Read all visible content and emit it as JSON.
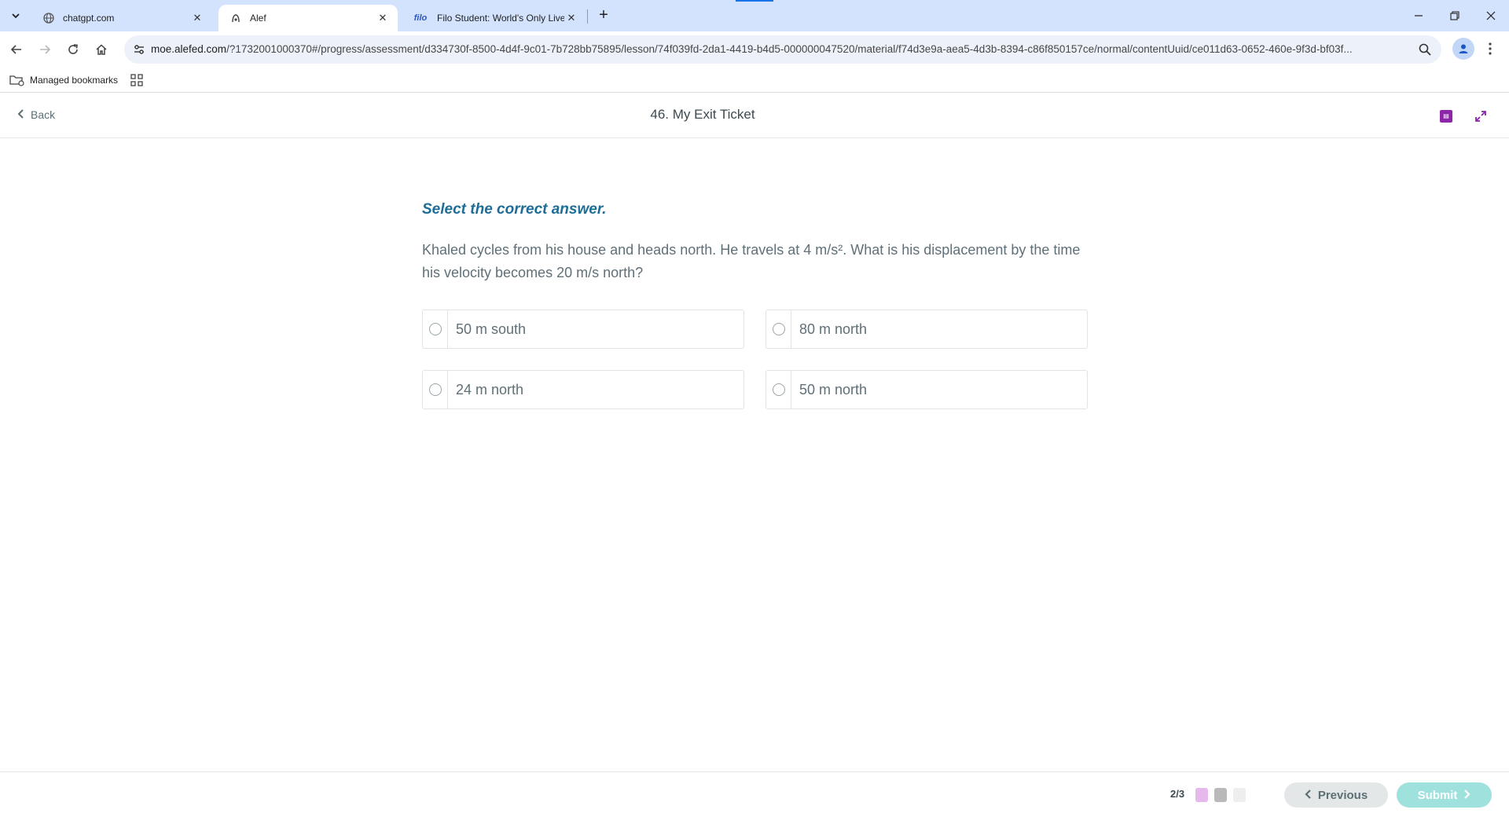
{
  "browser": {
    "tabs": [
      {
        "title": "chatgpt.com",
        "icon": "globe-icon"
      },
      {
        "title": "Alef",
        "icon": "alef-icon"
      },
      {
        "title": "Filo Student: World's Only Live",
        "icon": "filo-icon",
        "icon_text": "filo"
      }
    ],
    "url_host": "moe.alefed.com",
    "url_path": "/?1732001000370#/progress/assessment/d334730f-8500-4d4f-9c01-7b728bb75895/lesson/74f039fd-2da1-4419-b4d5-000000047520/material/f74d3e9a-aea5-4d3b-8394-c86f850157ce/normal/contentUuid/ce011d63-0652-460e-9f3d-bf03f...",
    "bookmarks_label": "Managed bookmarks"
  },
  "header": {
    "back_label": "Back",
    "title": "46. My Exit Ticket"
  },
  "question": {
    "instruction": "Select the correct answer.",
    "text": "Khaled cycles from his house and heads north. He travels at 4 m/s². What is his displacement by the time his velocity becomes 20 m/s north?",
    "options": [
      "50 m south",
      "80 m north",
      "24 m north",
      "50 m north"
    ]
  },
  "footer": {
    "pager": "2/3",
    "pager_colors": [
      "#e6b8ec",
      "#b9b9b9",
      "#eeeeee"
    ],
    "previous_label": "Previous",
    "submit_label": "Submit"
  },
  "colors": {
    "accent": "#1e6d96",
    "submit_disabled": "#9fe1dc",
    "brand_purple": "#8e24aa"
  }
}
